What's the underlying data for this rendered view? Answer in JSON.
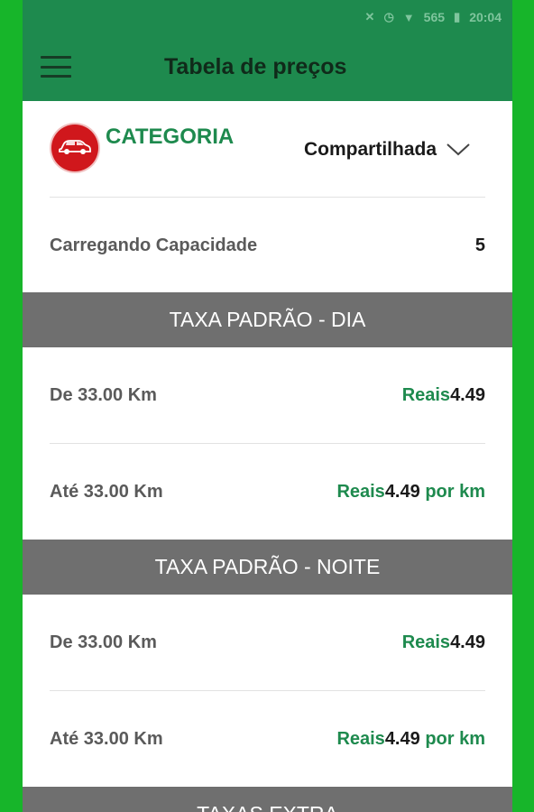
{
  "status_bar": {
    "time": "20:04",
    "signal": "565"
  },
  "app_bar": {
    "title": "Tabela de preços"
  },
  "category": {
    "label": "CATEGORIA",
    "selected": "Compartilhada"
  },
  "capacity": {
    "label": "Carregando Capacidade",
    "value": "5"
  },
  "sections": [
    {
      "title": "TAXA PADRÃO - DIA",
      "rows": [
        {
          "label": "De 33.00 Km",
          "currency": "Reais",
          "amount": "4.49",
          "suffix": ""
        },
        {
          "label": "Até 33.00 Km",
          "currency": "Reais",
          "amount": "4.49",
          "suffix": "por km"
        }
      ]
    },
    {
      "title": "TAXA PADRÃO - NOITE",
      "rows": [
        {
          "label": "De 33.00 Km",
          "currency": "Reais",
          "amount": "4.49",
          "suffix": ""
        },
        {
          "label": "Até 33.00 Km",
          "currency": "Reais",
          "amount": "4.49",
          "suffix": "por km"
        }
      ]
    },
    {
      "title": "TAXAS EXTRA"
    }
  ],
  "colors": {
    "outer_frame": "#17b52a",
    "app_bar": "#1e8a4e",
    "accent_green": "#1e8a4e",
    "section_header": "#6f6f6f",
    "badge_red": "#d0171c"
  },
  "icons": [
    "menu-icon",
    "car-icon",
    "chevron-down-icon"
  ]
}
